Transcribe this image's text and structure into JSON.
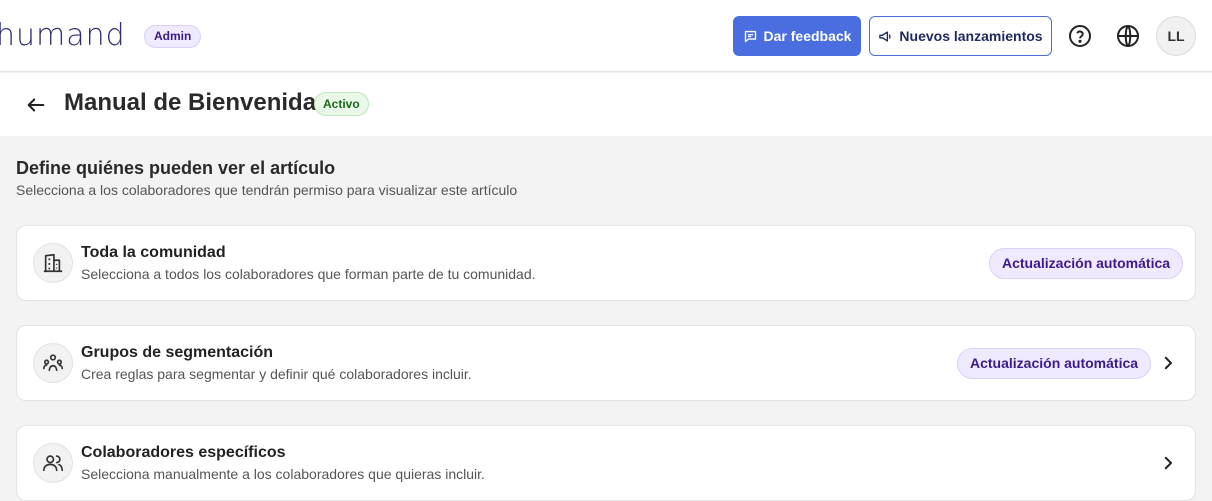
{
  "header": {
    "logo_text": "humand",
    "role_badge": "Admin",
    "feedback_label": "Dar feedback",
    "news_label": "Nuevos lanzamientos",
    "avatar_initials": "LL",
    "help_icon": "help-circle-icon",
    "language_icon": "globe-icon"
  },
  "page": {
    "title": "Manual de Bienvenida",
    "status": "Activo"
  },
  "section": {
    "title": "Define quiénes pueden ver el artículo",
    "subtitle": "Selecciona a los colaboradores que tendrán permiso para visualizar este artículo"
  },
  "options": [
    {
      "icon": "building-icon",
      "title": "Toda la comunidad",
      "description": "Selecciona a todos los colaboradores que forman parte de tu comunidad.",
      "badge": "Actualización automática"
    },
    {
      "icon": "segment-group-icon",
      "title": "Grupos de segmentación",
      "description": "Crea reglas para segmentar y definir qué colaboradores incluir.",
      "badge": "Actualización automática"
    },
    {
      "icon": "users-icon",
      "title": "Colaboradores específicos",
      "description": "Selecciona manualmente a los colaboradores que quieras incluir."
    }
  ],
  "colors": {
    "primary": "#4a6ee0",
    "badge_bg": "#efeaff",
    "badge_text": "#3c1a8c",
    "status_bg": "#eaf8ea",
    "status_text": "#1b6b1b"
  }
}
